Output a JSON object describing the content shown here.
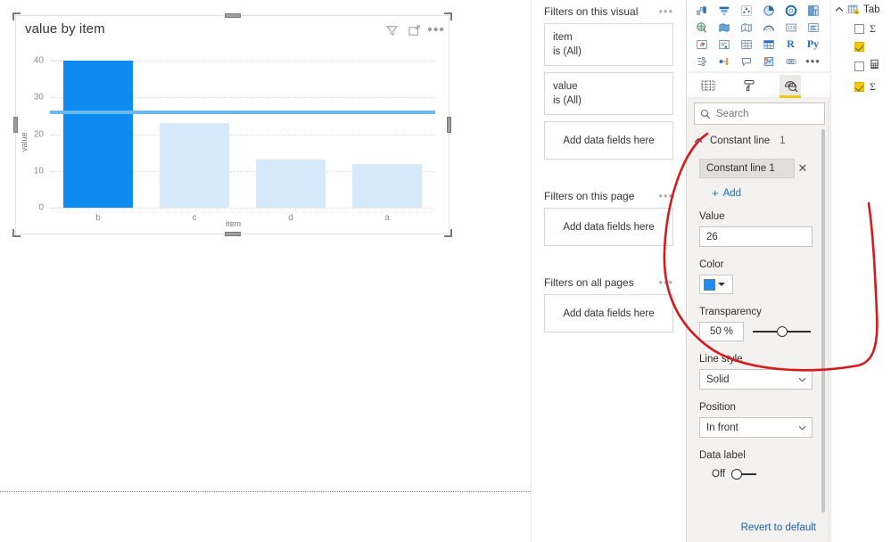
{
  "canvas": {
    "visual": {
      "title": "value by item",
      "header_icons": [
        {
          "name": "filter-icon",
          "glyph": "filter"
        },
        {
          "name": "focus-mode-icon",
          "glyph": "focus"
        },
        {
          "name": "more-options-icon",
          "glyph": "•••"
        }
      ]
    }
  },
  "chart_data": {
    "type": "bar",
    "title": "value by item",
    "xlabel": "item",
    "ylabel": "value",
    "categories": [
      "b",
      "c",
      "d",
      "a"
    ],
    "values": [
      40,
      23,
      13,
      12
    ],
    "ylim": [
      0,
      40
    ],
    "yticks": [
      0,
      10,
      20,
      30,
      40
    ],
    "grid": true,
    "legend": "none",
    "bar_colors": [
      "#0D8BF0",
      "#D6E9FB",
      "#D6E9FB",
      "#D6E9FB"
    ],
    "constant_line": {
      "name": "Constant line 1",
      "value": 26,
      "color": "#6BB9F2",
      "style": "Solid",
      "position": "In front",
      "transparency": 50
    }
  },
  "filters": {
    "groups": [
      {
        "title": "Filters on this visual",
        "cards": [
          {
            "field": "item",
            "state": "is (All)"
          },
          {
            "field": "value",
            "state": "is (All)"
          }
        ],
        "drop_label": "Add data fields here"
      },
      {
        "title": "Filters on this page",
        "cards": [],
        "drop_label": "Add data fields here"
      },
      {
        "title": "Filters on all pages",
        "cards": [],
        "drop_label": "Add data fields here"
      }
    ]
  },
  "viz_pane": {
    "gallery_rows": [
      [
        "waterfall-chart-icon",
        "funnel-chart-icon",
        "scatter-chart-icon",
        "pie-chart-icon",
        "donut-chart-icon",
        "treemap-icon"
      ],
      [
        "map-icon",
        "filled-map-icon",
        "shape-map-icon",
        "arcgis-map-icon",
        "card-icon",
        "multi-row-card-icon"
      ],
      [
        "kpi-icon",
        "slicer-icon",
        "table-icon",
        "matrix-icon",
        "r-visual-icon",
        "python-visual-icon"
      ],
      [
        "decomposition-tree-icon",
        "key-influencers-icon",
        "qna-icon",
        "smart-narrative-icon",
        "paginated-report-icon",
        "more-visuals-icon"
      ]
    ],
    "gallery_text": {
      "r": "R",
      "py": "Py",
      "dots": "•••"
    },
    "tabs": [
      {
        "name": "fields-tab",
        "label": "Fields",
        "active": false
      },
      {
        "name": "format-tab",
        "label": "Format",
        "active": false
      },
      {
        "name": "analytics-tab",
        "label": "Analytics",
        "active": true
      }
    ],
    "search": {
      "placeholder": "Search",
      "value": ""
    },
    "section": {
      "title": "Constant line",
      "count": "1"
    },
    "constant_line_item": {
      "label": "Constant line 1",
      "close": "✕"
    },
    "add": {
      "plus": "+",
      "label": "Add"
    },
    "value": {
      "label": "Value",
      "value": "26"
    },
    "color": {
      "label": "Color",
      "hex": "#1F8AF0"
    },
    "transparency": {
      "label": "Transparency",
      "value": "50",
      "unit": "%",
      "percent": 50
    },
    "line_style": {
      "label": "Line style",
      "value": "Solid"
    },
    "position": {
      "label": "Position",
      "value": "In front"
    },
    "data_label": {
      "label": "Data label",
      "state": "Off"
    },
    "revert": "Revert to default"
  },
  "fields_pane": {
    "table_name": "Tab",
    "items": [
      {
        "name": "field-checkbox-1",
        "checked": false,
        "icon": "sigma"
      },
      {
        "name": "field-checkbox-2",
        "checked": true,
        "icon": "none"
      },
      {
        "name": "field-checkbox-3",
        "checked": false,
        "icon": "calculator"
      },
      {
        "name": "field-checkbox-4",
        "checked": true,
        "icon": "sigma"
      }
    ],
    "sigma_glyph": "Σ"
  },
  "annotation": {
    "name": "red-ink-circle",
    "color": "#D51B1B"
  }
}
